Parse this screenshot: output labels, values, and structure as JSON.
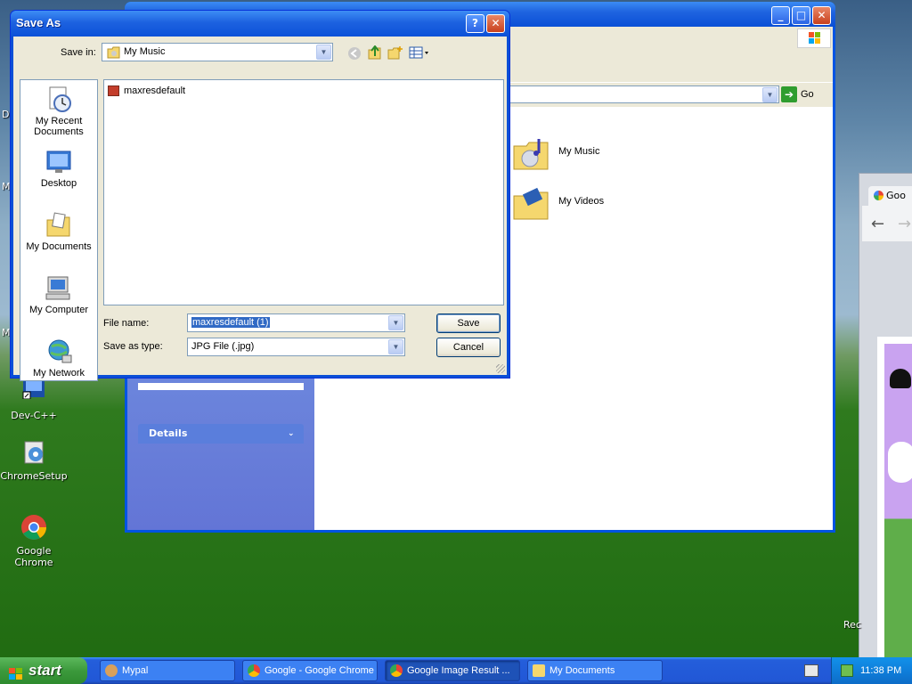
{
  "desktop": {
    "icons": [
      {
        "label": "Dev-C++"
      },
      {
        "label": "ChromeSetup"
      },
      {
        "label": "Google Chrome"
      }
    ],
    "edge_labels": [
      "D",
      "M",
      "M",
      "Rec"
    ]
  },
  "explorer": {
    "address_go": "Go",
    "items": [
      {
        "label": "My Music"
      },
      {
        "label": "My Videos"
      }
    ],
    "details_label": "Details"
  },
  "chrome_window": {
    "tab_label": "Goo"
  },
  "dialog": {
    "title": "Save As",
    "save_in_label": "Save in:",
    "save_in_value": "My Music",
    "places": [
      {
        "label": "My Recent Documents"
      },
      {
        "label": "Desktop"
      },
      {
        "label": "My Documents"
      },
      {
        "label": "My Computer"
      },
      {
        "label": "My Network"
      }
    ],
    "files": [
      {
        "name": "maxresdefault"
      }
    ],
    "file_name_label": "File name:",
    "file_name_value": "maxresdefault (1)",
    "save_type_label": "Save as type:",
    "save_type_value": "JPG File (.jpg)",
    "save_button": "Save",
    "cancel_button": "Cancel"
  },
  "taskbar": {
    "start_label": "start",
    "tasks": [
      {
        "label": "Mypal"
      },
      {
        "label": "Google - Google Chrome"
      },
      {
        "label": "Google Image Result ..."
      },
      {
        "label": "My Documents"
      }
    ],
    "clock": "11:38 PM"
  },
  "colors": {
    "xp_blue": "#0a4fd6",
    "start_green": "#3c9a3c",
    "selection": "#316ac5"
  }
}
